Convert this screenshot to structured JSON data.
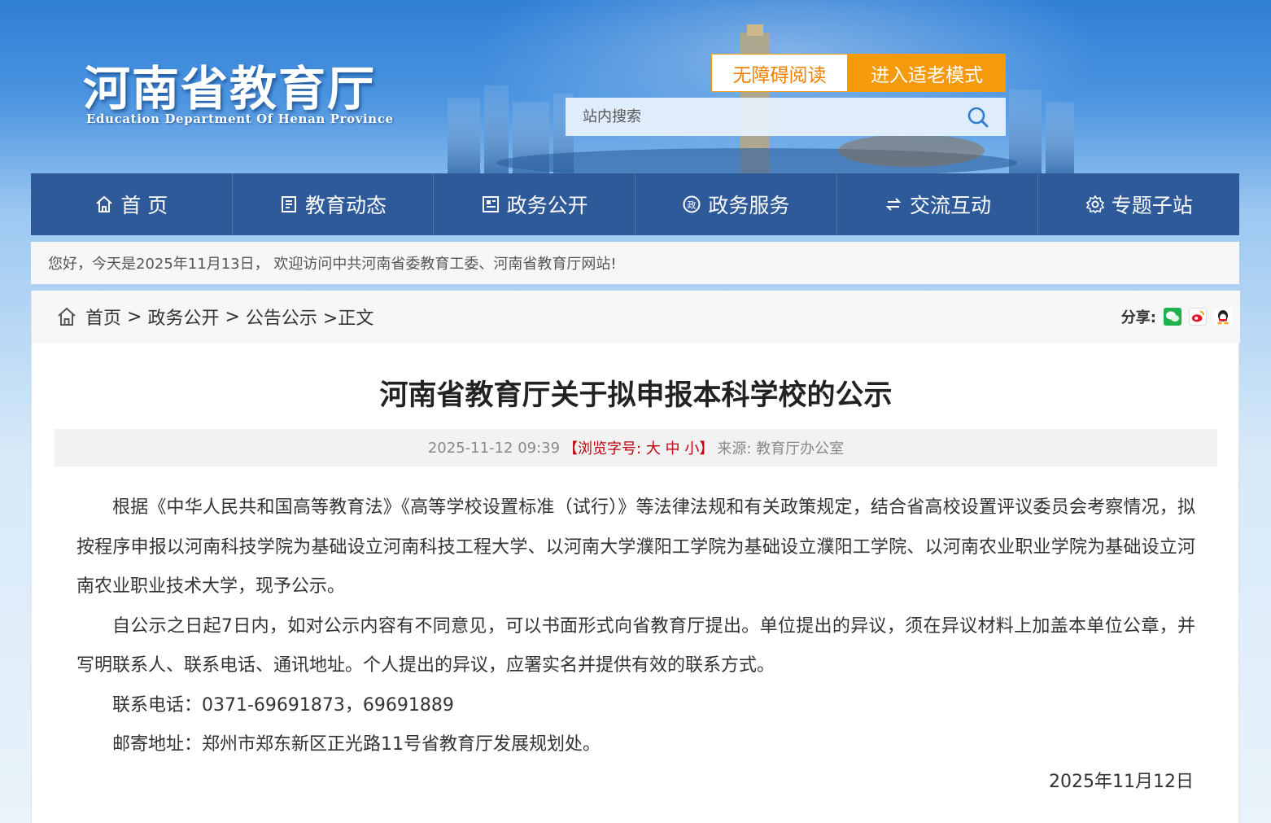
{
  "header": {
    "logo_cn": "河南省教育厅",
    "logo_en": "Education Department Of Henan Province",
    "accessibility_label": "无障碍阅读",
    "elder_mode_label": "进入适老模式",
    "search_placeholder": "站内搜索"
  },
  "nav": {
    "items": [
      {
        "label": "首 页",
        "icon": "home-icon"
      },
      {
        "label": "教育动态",
        "icon": "document-icon"
      },
      {
        "label": "政务公开",
        "icon": "newspaper-icon"
      },
      {
        "label": "政务服务",
        "icon": "service-icon"
      },
      {
        "label": "交流互动",
        "icon": "exchange-icon"
      },
      {
        "label": "专题子站",
        "icon": "gear-icon"
      }
    ]
  },
  "welcome": "您好，今天是2025年11月13日， 欢迎访问中共河南省委教育工委、河南省教育厅网站!",
  "breadcrumb": {
    "items": [
      "首页",
      "政务公开",
      "公告公示"
    ],
    "current": ">正文",
    "separator": ">"
  },
  "share": {
    "label": "分享:",
    "icons": [
      "wechat-icon",
      "weibo-icon",
      "qq-icon"
    ]
  },
  "article": {
    "title": "河南省教育厅关于拟申报本科学校的公示",
    "datetime": "2025-11-12 09:39",
    "font_prefix": "【浏览字号:",
    "font_large": "大",
    "font_medium": "中",
    "font_small": "小",
    "font_suffix": "】",
    "source": "来源: 教育厅办公室",
    "paragraphs": [
      "根据《中华人民共和国高等教育法》《高等学校设置标准（试行）》等法律法规和有关政策规定，结合省高校设置评议委员会考察情况，拟按程序申报以河南科技学院为基础设立河南科技工程大学、以河南大学濮阳工学院为基础设立濮阳工学院、以河南农业职业学院为基础设立河南农业职业技术大学，现予公示。",
      "自公示之日起7日内，如对公示内容有不同意见，可以书面形式向省教育厅提出。单位提出的异议，须在异议材料上加盖本单位公章，并写明联系人、联系电话、通讯地址。个人提出的异议，应署实名并提供有效的联系方式。",
      "联系电话：0371-69691873，69691889",
      "邮寄地址：郑州市郑东新区正光路11号省教育厅发展规划处。"
    ],
    "sign_date": "2025年11月12日"
  },
  "colors": {
    "nav_bg": "#2f5a9a",
    "accent_orange": "#f59a0b",
    "font_ctl_red": "#c0000c"
  }
}
